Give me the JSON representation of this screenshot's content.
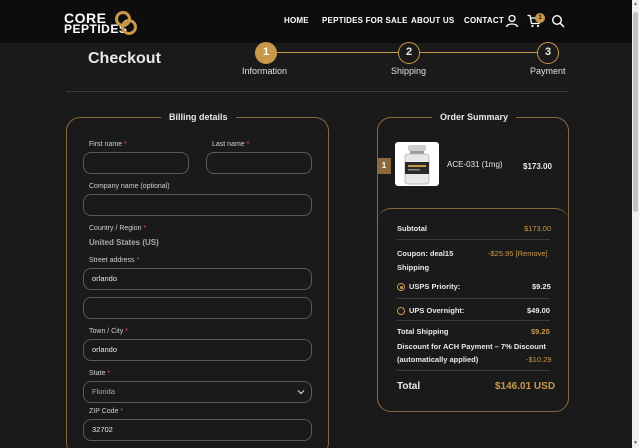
{
  "header": {
    "logo_line1": "CORE",
    "logo_line2": "PEPTIDES",
    "nav": [
      "HOME",
      "PEPTIDES FOR SALE",
      "ABOUT US",
      "CONTACT"
    ],
    "cart_count": "1"
  },
  "checkout": {
    "title": "Checkout",
    "steps": [
      {
        "number": "1",
        "label": "Information"
      },
      {
        "number": "2",
        "label": "Shipping"
      },
      {
        "number": "3",
        "label": "Payment"
      }
    ]
  },
  "billing": {
    "title": "Billing details",
    "first_name_label": "First name",
    "last_name_label": "Last name",
    "company_label": "Company name (optional)",
    "country_label": "Country / Region",
    "country_value": "United States (US)",
    "street_label": "Street address",
    "street_value": "orlando",
    "street2_value": "",
    "city_label": "Town / City",
    "city_value": "orlando",
    "state_label": "State",
    "state_value": "Florida",
    "zip_label": "ZIP Code",
    "zip_value": "32702",
    "required_mark": "*"
  },
  "summary": {
    "title": "Order Summary",
    "product": {
      "qty": "1",
      "name": "ACE-031 (1mg)",
      "price": "$173.00"
    },
    "subtotal_label": "Subtotal",
    "subtotal_value": "$173.00",
    "coupon_label": "Coupon: deal15",
    "coupon_value": "-$25.95",
    "coupon_remove": "[Remove]",
    "shipping_label": "Shipping",
    "shipping_options": [
      {
        "label": "USPS Priority:",
        "price": "$9.25",
        "selected": true
      },
      {
        "label": "UPS Overnight:",
        "price": "$49.00",
        "selected": false
      }
    ],
    "total_shipping_label": "Total Shipping",
    "total_shipping_value": "$9.25",
    "discount_line1": "Discount for ACH Payment – 7% Discount",
    "discount_line2": "(automatically applied)",
    "discount_value": "-$10.29",
    "total_label": "Total",
    "total_value": "$146.01 USD"
  },
  "colors": {
    "accent": "#c9974a",
    "background": "#1a1a1a",
    "header": "#0d0d0d"
  }
}
